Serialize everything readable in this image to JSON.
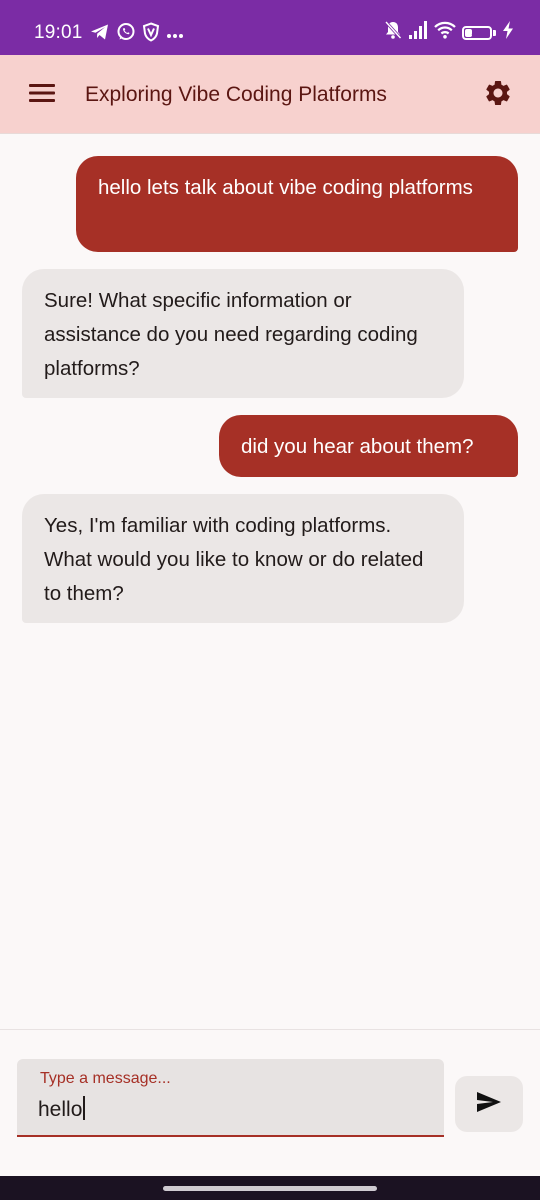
{
  "status_bar": {
    "time": "19:01",
    "battery_level": "29",
    "left_icons": [
      "telegram-icon",
      "whatsapp-icon",
      "vpn-shield-icon",
      "more-dots-icon"
    ],
    "right_icons": [
      "notifications-off-icon",
      "signal-icon",
      "wifi-icon",
      "battery-icon",
      "charging-bolt-icon"
    ]
  },
  "app_bar": {
    "title": "Exploring Vibe Coding Platforms",
    "menu_icon": "hamburger-menu-icon",
    "settings_icon": "gear-icon"
  },
  "messages": [
    {
      "role": "user",
      "text": "hello lets talk about vibe coding platforms"
    },
    {
      "role": "assistant",
      "text": "Sure! What specific information or assistance do you need regarding coding platforms?"
    },
    {
      "role": "user",
      "text": "did you hear about them?"
    },
    {
      "role": "assistant",
      "text": "Yes, I'm familiar with coding platforms. What would you like to know or do related to them?"
    }
  ],
  "composer": {
    "label": "Type a message...",
    "value": "hello",
    "send_icon": "send-icon"
  },
  "colors": {
    "status_bar": "#7b2ca5",
    "app_bar": "#f7d1ce",
    "user_bubble": "#a63026",
    "assistant_bubble": "#ebe7e6",
    "accent": "#a63026"
  }
}
